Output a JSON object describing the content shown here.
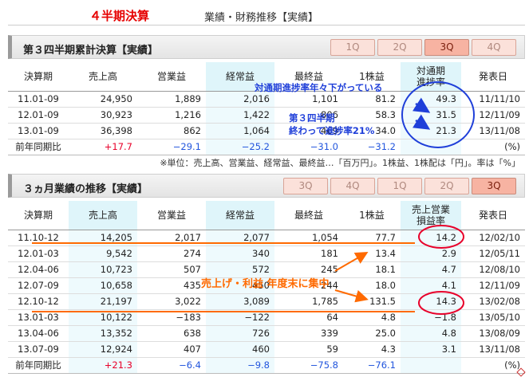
{
  "header": {
    "title": "４半期決算",
    "subtitle": "業績・財務推移【実績】"
  },
  "section1": {
    "title": "第３四半期累計決算【実績】",
    "tabs": [
      "1Q",
      "2Q",
      "3Q",
      "4Q"
    ],
    "active_tab": "3Q",
    "columns": [
      "決算期",
      "売上高",
      "営業益",
      "経常益",
      "最終益",
      "1株益",
      "対通期\n進捗率",
      "発表日"
    ],
    "rows": [
      [
        "11.01-09",
        "24,950",
        "1,889",
        "2,016",
        "1,101",
        "81.2",
        "49.3",
        "11/11/10"
      ],
      [
        "12.01-09",
        "30,923",
        "1,216",
        "1,422",
        "806",
        "58.3",
        "31.5",
        "12/11/09"
      ],
      [
        "13.01-09",
        "36,398",
        "862",
        "1,064",
        "469",
        "34.0",
        "21.3",
        "13/11/08"
      ]
    ],
    "comparison": [
      "前年同期比",
      "+17.7",
      "−29.1",
      "−25.2",
      "−31.0",
      "−31.2",
      "",
      "(%)"
    ]
  },
  "note": "※単位：売上高、営業益、経常益、最終益…「百万円」。1株益、1株配は「円」。率は「%」",
  "section2": {
    "title": "３ヵ月業績の推移【実績】",
    "tabs": [
      "3Q",
      "4Q",
      "1Q",
      "2Q",
      "3Q"
    ],
    "active_index": 4,
    "columns": [
      "決算期",
      "売上高",
      "営業益",
      "経常益",
      "最終益",
      "1株益",
      "売上営業\n損益率",
      "発表日"
    ],
    "rows": [
      [
        "11.10-12",
        "14,205",
        "2,017",
        "2,077",
        "1,054",
        "77.7",
        "14.2",
        "12/02/10"
      ],
      [
        "12.01-03",
        "9,542",
        "274",
        "340",
        "181",
        "13.4",
        "2.9",
        "12/05/11"
      ],
      [
        "12.04-06",
        "10,723",
        "507",
        "572",
        "245",
        "18.1",
        "4.7",
        "12/08/10"
      ],
      [
        "12.07-09",
        "10,658",
        "435",
        "450",
        "244",
        "18.0",
        "4.1",
        "12/11/09"
      ],
      [
        "12.10-12",
        "21,197",
        "3,022",
        "3,089",
        "1,785",
        "131.5",
        "14.3",
        "13/02/08"
      ],
      [
        "13.01-03",
        "10,122",
        "−183",
        "−122",
        "64",
        "4.8",
        "−1.8",
        "13/05/10"
      ],
      [
        "13.04-06",
        "13,352",
        "638",
        "726",
        "339",
        "25.0",
        "4.8",
        "13/08/09"
      ],
      [
        "13.07-09",
        "12,924",
        "407",
        "460",
        "59",
        "4.3",
        "3.1",
        "13/11/08"
      ]
    ],
    "comparison": [
      "前年同期比",
      "+21.3",
      "−6.4",
      "−9.8",
      "−75.8",
      "−76.1",
      "",
      "(%)"
    ]
  },
  "annotations": {
    "progress_note": "対通期進捗率年々下がっている",
    "q3_note_line1": "第３四半期",
    "q3_note_line2": "終わって進捗率21%",
    "year_end_note": "売上げ・利益  年度末に集中"
  },
  "colors": {
    "title_red": "#e60000",
    "annotation_blue": "#1f3fd9",
    "annotation_orange": "#ff6a00",
    "annotation_red_circle": "#e8002a",
    "highlight_column": "#dff5fa",
    "tab_active": "#f7b3a2",
    "tab_inactive": "#fbe1da"
  }
}
